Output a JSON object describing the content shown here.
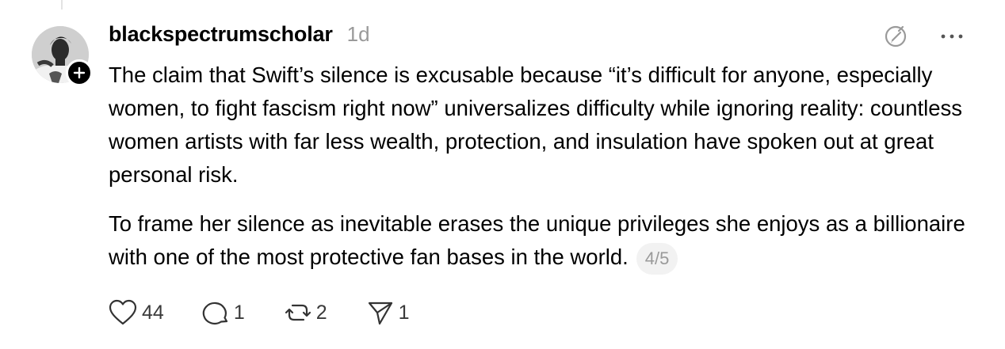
{
  "post": {
    "username": "blackspectrumscholar",
    "timestamp": "1d",
    "paragraph1": "The claim that Swift’s silence is excusable because “it’s difficult for anyone, especially women, to fight fascism right now” universalizes difficulty while ignoring reality: countless women artists with far less wealth, protection, and insulation have spoken out at great personal risk.",
    "paragraph2": "To frame her silence as inevitable erases the unique privileges she enjoys as a billionaire with one of the most protective fan bases in the world.",
    "page_indicator": "4/5"
  },
  "actions": {
    "likes": "44",
    "replies": "1",
    "reposts": "2",
    "shares": "1"
  },
  "icons": [
    "plus-icon",
    "translate-icon",
    "more-icon",
    "heart-icon",
    "comment-icon",
    "repost-icon",
    "share-icon"
  ],
  "colors": {
    "text": "#000000",
    "muted": "#9a9a9a",
    "counts": "#3a3a3a"
  }
}
